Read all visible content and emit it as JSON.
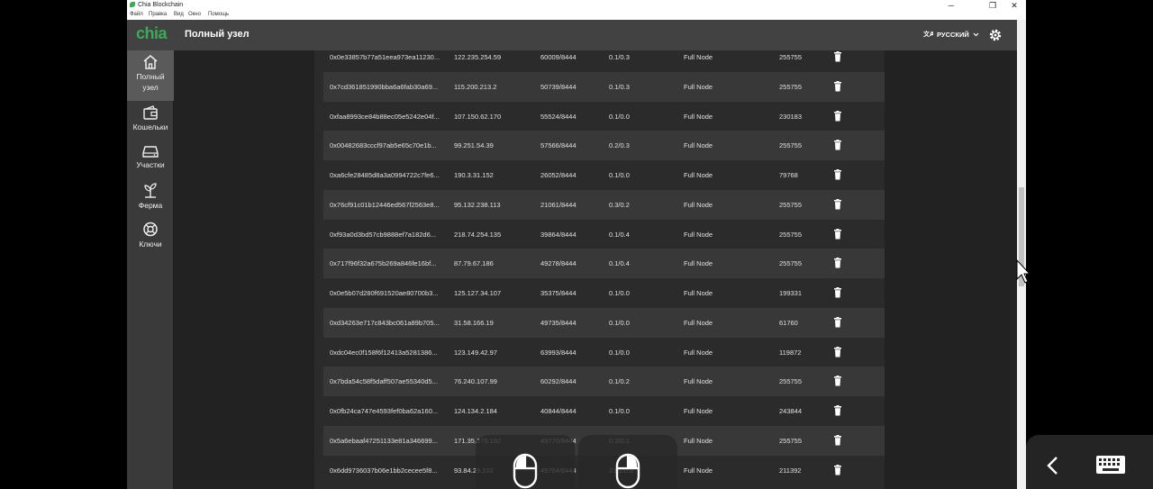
{
  "window": {
    "title": "Chia Blockchain",
    "controls": {
      "minimize": "─",
      "restore": "❐",
      "close": "✕"
    },
    "menu": [
      "Файл",
      "Правка",
      "Вид",
      "Окно",
      "Помощь"
    ]
  },
  "header": {
    "brand": "chia",
    "page_title": "Полный узел",
    "language": "РУССКИЙ",
    "icons": {
      "language": "translate-icon",
      "dropdown": "chevron-down-icon",
      "settings": "gear-icon"
    }
  },
  "sidebar": {
    "items": [
      {
        "label_line1": "Полный",
        "label_line2": "узел",
        "icon": "home-icon",
        "active": true
      },
      {
        "label": "Кошельки",
        "icon": "wallet-icon"
      },
      {
        "label": "Участки",
        "icon": "hard-drive-icon"
      },
      {
        "label": "Ферма",
        "icon": "plant-icon"
      },
      {
        "label": "Ключи",
        "icon": "lifebuoy-icon"
      }
    ]
  },
  "connections": {
    "rows": [
      {
        "node_id": "0x0e33857b77a51eea973ea11230...",
        "ip": "122.235.254.59",
        "ports": "60009/8444",
        "up_down": "0.1/0.3",
        "type": "Full Node",
        "height": "255755"
      },
      {
        "node_id": "0x7cd361851990bba6a6fab30a69...",
        "ip": "115.200.213.2",
        "ports": "50739/8444",
        "up_down": "0.1/0.3",
        "type": "Full Node",
        "height": "255755"
      },
      {
        "node_id": "0xfaa8993ce84b88ec05e5242e04f...",
        "ip": "107.150.62.170",
        "ports": "55524/8444",
        "up_down": "0.1/0.0",
        "type": "Full Node",
        "height": "230183"
      },
      {
        "node_id": "0x00482683cccf97ab5e65c70e1b...",
        "ip": "99.251.54.39",
        "ports": "57566/8444",
        "up_down": "0.2/0.3",
        "type": "Full Node",
        "height": "255755"
      },
      {
        "node_id": "0xa6cfe28485d8a3a0994722c7fe6...",
        "ip": "190.3.31.152",
        "ports": "26052/8444",
        "up_down": "0.1/0.0",
        "type": "Full Node",
        "height": "79768"
      },
      {
        "node_id": "0x76cf91c01b12446ed567f2563e8...",
        "ip": "95.132.238.113",
        "ports": "21061/8444",
        "up_down": "0.3/0.2",
        "type": "Full Node",
        "height": "255755"
      },
      {
        "node_id": "0xf93a0d3bd57cb9888ef7a182d6...",
        "ip": "218.74.254.135",
        "ports": "39864/8444",
        "up_down": "0.1/0.4",
        "type": "Full Node",
        "height": "255755"
      },
      {
        "node_id": "0x717f96f32a675b269a846fe16bf...",
        "ip": "87.79.67.186",
        "ports": "49278/8444",
        "up_down": "0.1/0.4",
        "type": "Full Node",
        "height": "255755"
      },
      {
        "node_id": "0x0e5b07d280f691520ae80700b3...",
        "ip": "125.127.34.107",
        "ports": "35375/8444",
        "up_down": "0.1/0.0",
        "type": "Full Node",
        "height": "199331"
      },
      {
        "node_id": "0xd34263e717c843bc061a89b705...",
        "ip": "31.58.166.19",
        "ports": "49735/8444",
        "up_down": "0.1/0.0",
        "type": "Full Node",
        "height": "61760"
      },
      {
        "node_id": "0xdc04ec0f158f6f12413a5281386...",
        "ip": "123.149.42.97",
        "ports": "63993/8444",
        "up_down": "0.1/0.0",
        "type": "Full Node",
        "height": "119872"
      },
      {
        "node_id": "0x7bda54c58f5daff507ae55340d5...",
        "ip": "76.240.107.99",
        "ports": "60292/8444",
        "up_down": "0.1/0.2",
        "type": "Full Node",
        "height": "255755"
      },
      {
        "node_id": "0x0fb24ca747e4593fef0ba62a160...",
        "ip": "124.134.2.184",
        "ports": "40844/8444",
        "up_down": "0.1/0.0",
        "type": "Full Node",
        "height": "243844"
      },
      {
        "node_id": "0x5a6ebaaf47251133e81a346699...",
        "ip": "171.35.179.192",
        "ports": "49770/8444",
        "up_down": "0.2/0.1",
        "type": "Full Node",
        "height": "255755"
      },
      {
        "node_id": "0x6dd9736037b06e1bb2cecee5f8...",
        "ip": "93.84.29.102",
        "ports": "49794/8444",
        "up_down": "23.1/0.8",
        "type": "Full Node",
        "height": "211392"
      }
    ],
    "delete_icon": "trash-icon"
  },
  "overlay": {
    "buttons": [
      "mouse-left-icon",
      "mouse-right-icon"
    ],
    "corner": {
      "back": "chevron-left-icon",
      "keyboard": "keyboard-icon"
    }
  },
  "colors": {
    "brand": "#3aac59",
    "appbar": "#424242",
    "sidebar": "#3a3a3a",
    "row_alt": "#383838"
  }
}
